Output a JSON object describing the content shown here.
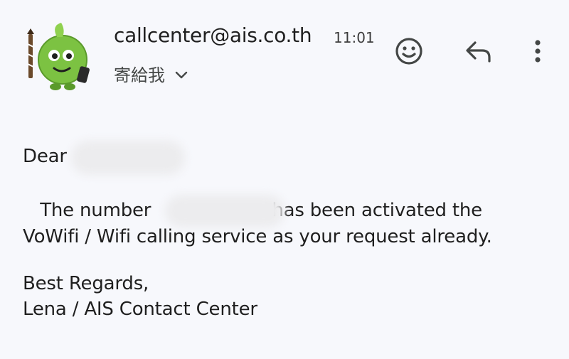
{
  "header": {
    "sender": "callcenter@ais.co.th",
    "time": "11:01",
    "recipient_label": "寄給我",
    "avatar_icon": "ais-mascot-avatar",
    "actions": {
      "react_icon": "smiley-face-icon",
      "reply_icon": "reply-arrow-icon",
      "more_icon": "vertical-dots-icon"
    }
  },
  "message": {
    "greeting": "Dear",
    "line1_prefix": "The number",
    "line1_suffix": "has been activated the",
    "line2": "VoWifi / Wifi calling service as your request already.",
    "closing": "Best Regards,",
    "signature": "Lena / AIS Contact Center"
  },
  "colors": {
    "background": "#f7f8fc",
    "text": "#1f1f1f",
    "mascot_green": "#7cc242"
  }
}
